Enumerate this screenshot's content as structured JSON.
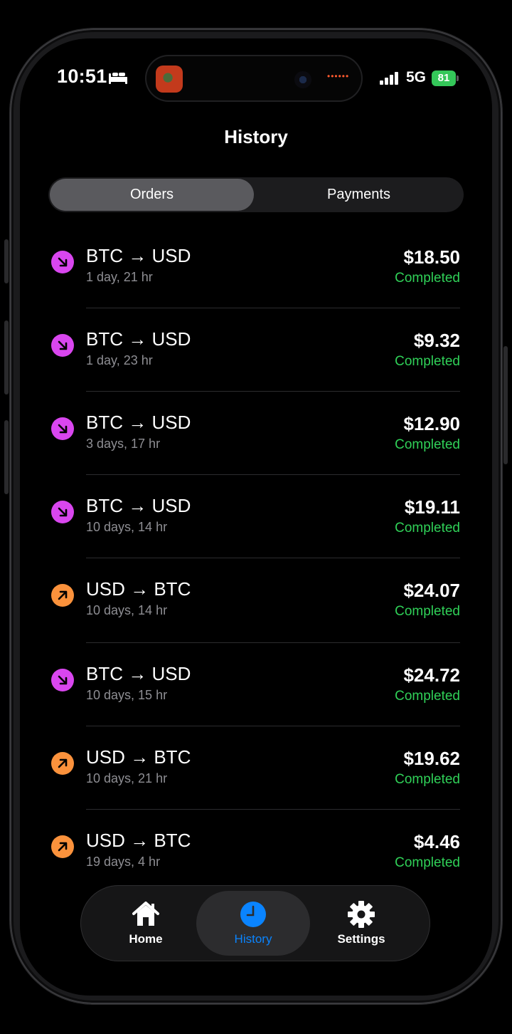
{
  "status_bar": {
    "time": "10:51",
    "network": "5G",
    "battery": "81"
  },
  "header": {
    "title": "History"
  },
  "segmented": {
    "tabs": [
      {
        "label": "Orders",
        "active": true
      },
      {
        "label": "Payments",
        "active": false
      }
    ]
  },
  "colors": {
    "sell": "#d946ef",
    "buy": "#fb923c",
    "completed": "#30d158",
    "accent": "#0a84ff"
  },
  "orders": [
    {
      "direction": "sell",
      "pair": "BTC → USD",
      "time": "1 day, 21 hr",
      "amount": "$18.50",
      "status": "Completed"
    },
    {
      "direction": "sell",
      "pair": "BTC → USD",
      "time": "1 day, 23 hr",
      "amount": "$9.32",
      "status": "Completed"
    },
    {
      "direction": "sell",
      "pair": "BTC → USD",
      "time": "3 days, 17 hr",
      "amount": "$12.90",
      "status": "Completed"
    },
    {
      "direction": "sell",
      "pair": "BTC → USD",
      "time": "10 days, 14 hr",
      "amount": "$19.11",
      "status": "Completed"
    },
    {
      "direction": "buy",
      "pair": "USD → BTC",
      "time": "10 days, 14 hr",
      "amount": "$24.07",
      "status": "Completed"
    },
    {
      "direction": "sell",
      "pair": "BTC → USD",
      "time": "10 days, 15 hr",
      "amount": "$24.72",
      "status": "Completed"
    },
    {
      "direction": "buy",
      "pair": "USD → BTC",
      "time": "10 days, 21 hr",
      "amount": "$19.62",
      "status": "Completed"
    },
    {
      "direction": "buy",
      "pair": "USD → BTC",
      "time": "19 days, 4 hr",
      "amount": "$4.46",
      "status": "Completed"
    }
  ],
  "tabbar": {
    "items": [
      {
        "label": "Home",
        "icon": "home-icon"
      },
      {
        "label": "History",
        "icon": "clock-icon",
        "active": true
      },
      {
        "label": "Settings",
        "icon": "gear-icon"
      }
    ]
  }
}
